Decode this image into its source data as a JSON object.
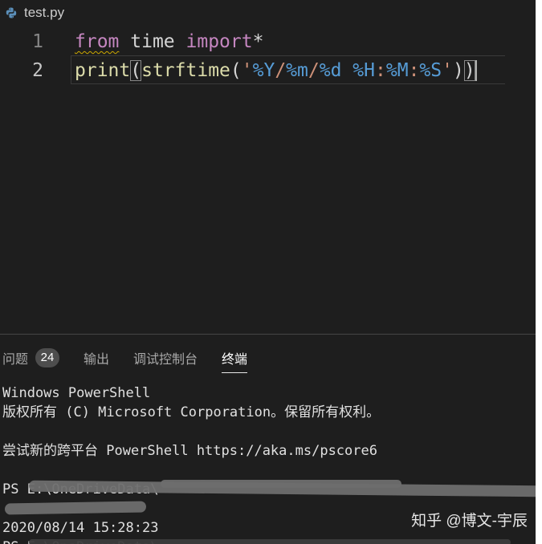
{
  "editor_tab": {
    "filename": "test.py",
    "icon": "python-file-icon"
  },
  "editor": {
    "line_numbers": [
      "1",
      "2"
    ],
    "line1": {
      "from": "from",
      "space1": " ",
      "module": "time",
      "space2": " ",
      "import": "import",
      "star": "*"
    },
    "line2": {
      "print": "print",
      "open_paren": "(",
      "strftime": "strftime",
      "open_paren2": "(",
      "str_open": "'",
      "y": "%Y",
      "slash1": "/",
      "m": "%m",
      "slash2": "/",
      "d": "%d",
      "space": " ",
      "h": "%H",
      "colon1": ":",
      "mm": "%M",
      "colon2": ":",
      "s": "%S",
      "str_close": "'",
      "close_paren2": ")",
      "close_paren": ")"
    }
  },
  "panel": {
    "tabs": [
      {
        "label": "问题",
        "badge": "24"
      },
      {
        "label": "输出"
      },
      {
        "label": "调试控制台"
      },
      {
        "label": "终端",
        "active": true
      }
    ]
  },
  "terminal": {
    "lines": [
      "Windows PowerShell",
      "版权所有 (C) Microsoft Corporation。保留所有权利。",
      "",
      "尝试新的跨平台 PowerShell https://aka.ms/pscore6",
      "",
      "PS E:\\OneDriveData\\",
      "",
      "2020/08/14 15:28:23",
      "PS E:\\OneDriveData\\"
    ]
  },
  "watermark": "知乎 @博文-宇辰"
}
